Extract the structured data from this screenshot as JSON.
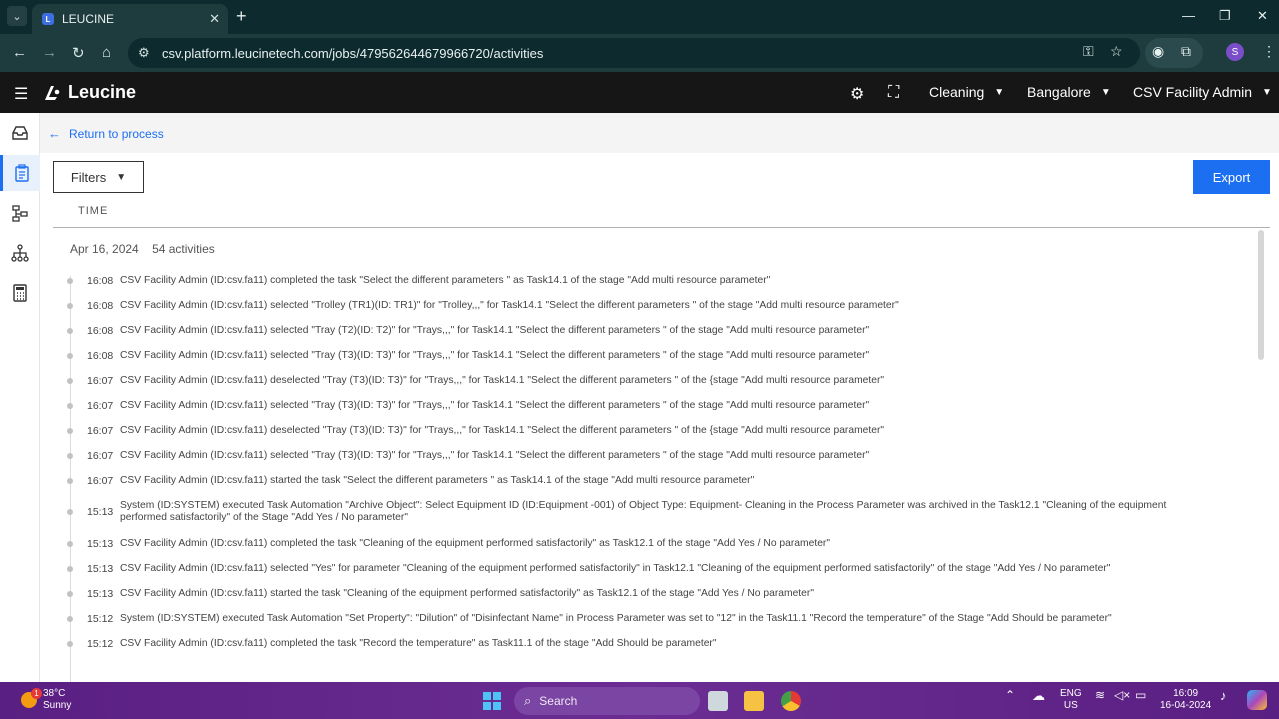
{
  "browser": {
    "tab_title": "LEUCINE",
    "url": "csv.platform.leucinetech.com/jobs/479562644679966720/activities",
    "profile_initial": "S"
  },
  "app": {
    "logo_text": "Leucine",
    "use_case": "Cleaning",
    "facility": "Bangalore",
    "user": "CSV Facility Admin"
  },
  "page": {
    "back_label": "Return to process",
    "filters_label": "Filters",
    "export_label": "Export",
    "column_header": "TIME",
    "date": "Apr 16, 2024",
    "activity_count": "54 activities"
  },
  "activities": [
    {
      "time": "16:08",
      "text": "CSV Facility Admin (ID:csv.fa11) completed the task \"Select the different parameters \" as Task14.1 of the stage \"Add multi resource parameter\""
    },
    {
      "time": "16:08",
      "text": "CSV Facility Admin (ID:csv.fa11) selected \"Trolley (TR1)(ID: TR1)\" for \"Trolley,,,\" for Task14.1 \"Select the different parameters \" of the stage \"Add multi resource parameter\""
    },
    {
      "time": "16:08",
      "text": "CSV Facility Admin (ID:csv.fa11) selected \"Tray (T2)(ID: T2)\" for \"Trays,,,\" for Task14.1 \"Select the different parameters \" of the stage \"Add multi resource parameter\""
    },
    {
      "time": "16:08",
      "text": "CSV Facility Admin (ID:csv.fa11) selected \"Tray (T3)(ID: T3)\" for \"Trays,,,\" for Task14.1 \"Select the different parameters \" of the stage \"Add multi resource parameter\""
    },
    {
      "time": "16:07",
      "text": "CSV Facility Admin (ID:csv.fa11) deselected \"Tray (T3)(ID: T3)\" for \"Trays,,,\" for Task14.1 \"Select the different parameters \" of the {stage \"Add multi resource parameter\""
    },
    {
      "time": "16:07",
      "text": "CSV Facility Admin (ID:csv.fa11) selected \"Tray (T3)(ID: T3)\" for \"Trays,,,\" for Task14.1 \"Select the different parameters \" of the stage \"Add multi resource parameter\""
    },
    {
      "time": "16:07",
      "text": "CSV Facility Admin (ID:csv.fa11) deselected \"Tray (T3)(ID: T3)\" for \"Trays,,,\" for Task14.1 \"Select the different parameters \" of the {stage \"Add multi resource parameter\""
    },
    {
      "time": "16:07",
      "text": "CSV Facility Admin (ID:csv.fa11) selected \"Tray (T3)(ID: T3)\" for \"Trays,,,\" for Task14.1 \"Select the different parameters \" of the stage \"Add multi resource parameter\""
    },
    {
      "time": "16:07",
      "text": "CSV Facility Admin (ID:csv.fa11) started the task \"Select the different parameters \" as Task14.1 of the stage \"Add multi resource parameter\""
    },
    {
      "time": "15:13",
      "text": "System (ID:SYSTEM) executed Task Automation \"Archive Object\": Select Equipment ID (ID:Equipment -001) of Object Type: Equipment- Cleaning in the Process Parameter was archived in the Task12.1 \"Cleaning of the equipment performed satisfactorily\" of the Stage \"Add Yes / No parameter\""
    },
    {
      "time": "15:13",
      "text": "CSV Facility Admin (ID:csv.fa11) completed the task \"Cleaning of the equipment performed satisfactorily\" as Task12.1 of the stage \"Add Yes / No parameter\""
    },
    {
      "time": "15:13",
      "text": "CSV Facility Admin (ID:csv.fa11) selected \"Yes\" for parameter \"Cleaning of the equipment performed satisfactorily\" in Task12.1 \"Cleaning of the equipment performed satisfactorily\" of the stage \"Add Yes / No parameter\""
    },
    {
      "time": "15:13",
      "text": "CSV Facility Admin (ID:csv.fa11) started the task \"Cleaning of the equipment performed satisfactorily\" as Task12.1 of the stage \"Add Yes / No parameter\""
    },
    {
      "time": "15:12",
      "text": "System (ID:SYSTEM) executed Task Automation \"Set Property\": \"Dilution\" of \"Disinfectant Name\" in Process Parameter was set to \"12\" in the Task11.1 \"Record the temperature\" of the Stage \"Add Should be parameter\""
    },
    {
      "time": "15:12",
      "text": "CSV Facility Admin (ID:csv.fa11) completed the task \"Record the temperature\" as Task11.1 of the stage \"Add Should be parameter\""
    }
  ],
  "taskbar": {
    "temperature": "38°C",
    "weather": "Sunny",
    "weather_badge": "1",
    "search_label": "Search",
    "lang_line1": "ENG",
    "lang_line2": "US",
    "time": "16:09",
    "date": "16-04-2024"
  },
  "colors": {
    "accent": "#1d6ff2",
    "header_bg": "#161616",
    "chrome_bg": "#0d2b2e",
    "taskbar_bg": "#6b2d93"
  }
}
